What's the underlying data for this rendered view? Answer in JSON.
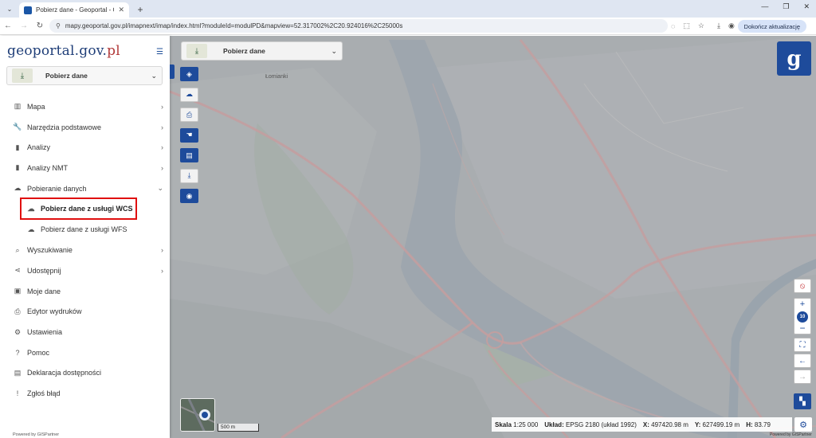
{
  "browser": {
    "tab_title": "Pobierz dane - Geoportal - GUGiK",
    "url": "mapy.geoportal.gov.pl/imapnext/imap/index.html?moduleId=modulPD&mapview=52.317002%2C20.924016%2C25000s",
    "update_button": "Dokończ aktualizację"
  },
  "sidebar": {
    "logo_g": "g",
    "logo_main": "eoportal.gov.",
    "logo_pl": "pl",
    "module_label": "Pobierz dane",
    "items": [
      {
        "label": "Mapa",
        "icon": "columns-icon",
        "glyph": "▥",
        "arrow": "›"
      },
      {
        "label": "Narzędzia podstawowe",
        "icon": "wrench-icon",
        "glyph": "🔧",
        "arrow": "›"
      },
      {
        "label": "Analizy",
        "icon": "bar-chart-icon",
        "glyph": "▮",
        "arrow": "›"
      },
      {
        "label": "Analizy NMT",
        "icon": "bar-chart-icon",
        "glyph": "▮",
        "arrow": "›"
      },
      {
        "label": "Pobieranie danych",
        "icon": "cloud-download-icon",
        "glyph": "☁",
        "arrow": "⌄"
      },
      {
        "label": "Pobierz dane z usługi WCS",
        "icon": "cloud-download-icon",
        "glyph": "☁",
        "sub": true,
        "active": true
      },
      {
        "label": "Pobierz dane z usługi WFS",
        "icon": "cloud-download-icon",
        "glyph": "☁",
        "sub": true
      },
      {
        "label": "Wyszukiwanie",
        "icon": "search-icon",
        "glyph": "⌕",
        "arrow": "›"
      },
      {
        "label": "Udostępnij",
        "icon": "share-icon",
        "glyph": "⋖",
        "arrow": "›"
      },
      {
        "label": "Moje dane",
        "icon": "floppy-icon",
        "glyph": "▣"
      },
      {
        "label": "Edytor wydruków",
        "icon": "printer-icon",
        "glyph": "⎙"
      },
      {
        "label": "Ustawienia",
        "icon": "gear-icon",
        "glyph": "⚙"
      },
      {
        "label": "Pomoc",
        "icon": "help-icon",
        "glyph": "?"
      },
      {
        "label": "Deklaracja dostępności",
        "icon": "id-card-icon",
        "glyph": "▤"
      },
      {
        "label": "Zgłoś błąd",
        "icon": "alert-icon",
        "glyph": "!"
      }
    ],
    "powered_by": "Powered by GISPartner"
  },
  "map": {
    "module_label": "Pobierz dane",
    "place_label": "Łomianki",
    "logo_letter": "g",
    "zoom_level": "10",
    "scale_bar": "500 m",
    "status": {
      "scale_label": "Skala",
      "scale_value": "1:25 000",
      "crs_label": "Układ:",
      "crs_value": "EPSG 2180 (układ 1992)",
      "x_label": "X:",
      "x_value": "497420.98 m",
      "y_label": "Y:",
      "y_value": "627499.19 m",
      "h_label": "H:",
      "h_value": "83.79"
    },
    "powered_by": "Powered by GISPartner"
  },
  "colors": {
    "accent": "#1e4b9b",
    "highlight": "#e01010",
    "river": "#9aa4ad",
    "road": "#c7a0a0"
  }
}
